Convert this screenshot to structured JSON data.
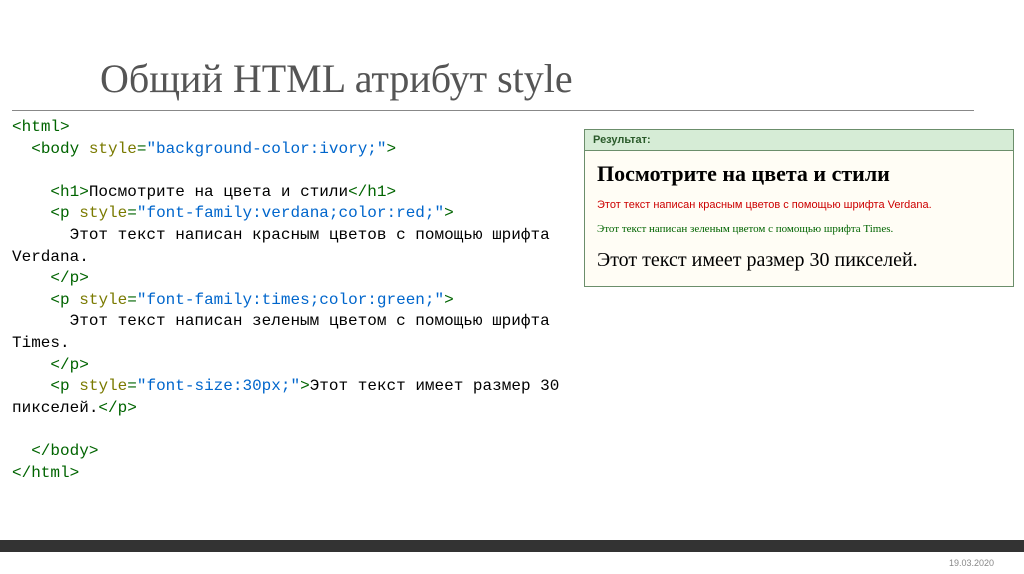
{
  "title": "Общий HTML атрибут style",
  "code": {
    "l1a": "<",
    "l1b": "html",
    "l1c": ">",
    "l2a": "  <",
    "l2b": "body",
    "l2sp": " ",
    "l2c": "style",
    "l2d": "=",
    "l2e": "\"background-color:ivory;\"",
    "l2f": ">",
    "l3": "",
    "l4a": "    <",
    "l4b": "h1",
    "l4c": ">",
    "l4d": "Посмотрите на цвета и стили",
    "l4e": "</",
    "l4f": "h1",
    "l4g": ">",
    "l5a": "    <",
    "l5b": "p",
    "l5sp": " ",
    "l5c": "style",
    "l5d": "=",
    "l5e": "\"font-family:verdana;color:red;\"",
    "l5f": ">",
    "l6": "      Этот текст написан красным цветов с помощью шрифта Verdana.",
    "l7a": "    </",
    "l7b": "p",
    "l7c": ">",
    "l8a": "    <",
    "l8b": "p",
    "l8sp": " ",
    "l8c": "style",
    "l8d": "=",
    "l8e": "\"font-family:times;color:green;\"",
    "l8f": ">",
    "l9": "      Этот текст написан зеленым цветом с помощью шрифта Times.",
    "l10a": "    </",
    "l10b": "p",
    "l10c": ">",
    "l11a": "    <",
    "l11b": "p",
    "l11sp": " ",
    "l11c": "style",
    "l11d": "=",
    "l11e": "\"font-size:30px;\"",
    "l11f": ">",
    "l11g": "Этот текст имеет размер 30 пикселей.",
    "l11h": "</",
    "l11i": "p",
    "l11j": ">",
    "l12": "",
    "l13a": "  </",
    "l13b": "body",
    "l13c": ">",
    "l14a": "</",
    "l14b": "html",
    "l14c": ">"
  },
  "result": {
    "header": "Результат:",
    "h1": "Посмотрите на цвета и стили",
    "p1": "Этот текст написан красным цветов с помощью шрифта Verdana.",
    "p2": "Этот текст написан зеленым цветом с помощью шрифта Times.",
    "p3": "Этот текст имеет размер 30 пикселей."
  },
  "date": "19.03.2020"
}
